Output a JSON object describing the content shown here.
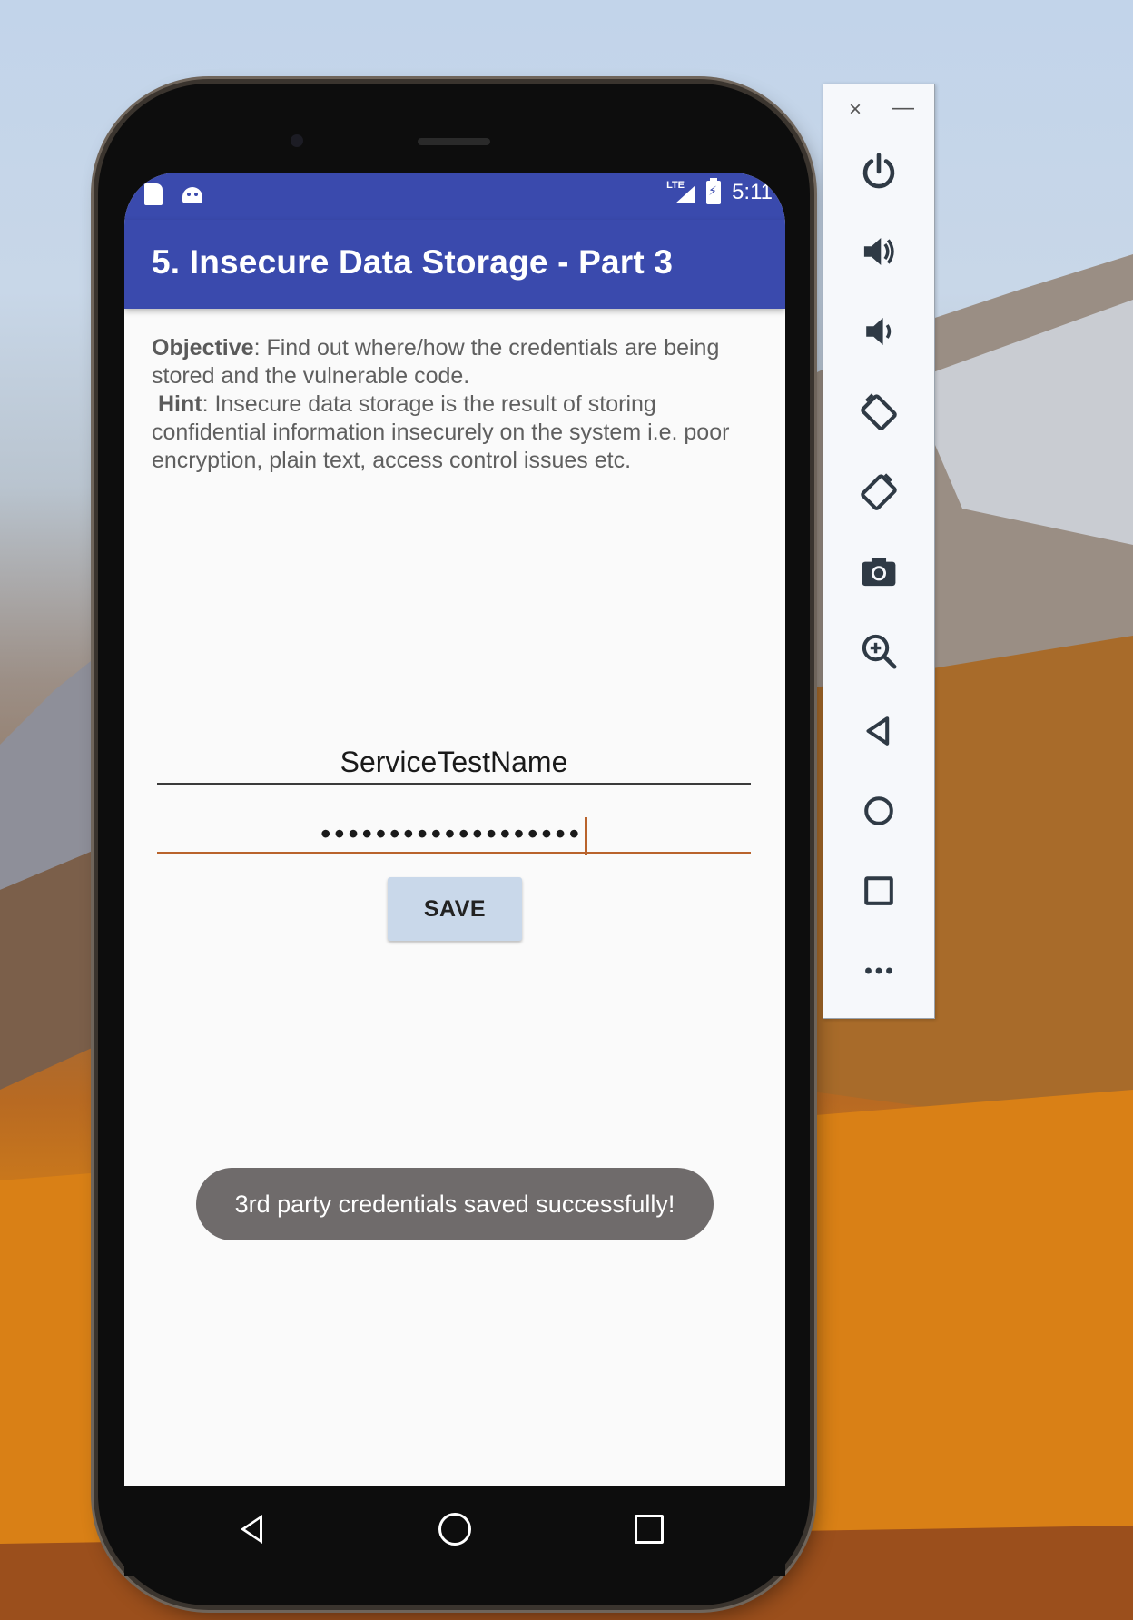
{
  "status_bar": {
    "time": "5:11",
    "network": "LTE"
  },
  "app_bar": {
    "title": "5. Insecure Data Storage - Part 3"
  },
  "content": {
    "objective_label": "Objective",
    "objective_text": ": Find out where/how the credentials are being stored and the vulnerable code.",
    "hint_label": "Hint",
    "hint_text": ": Insecure data storage is the result of storing confidential information insecurely on the system i.e. poor encryption, plain text, access control issues etc."
  },
  "form": {
    "username_value": "ServiceTestName",
    "password_value": "•••••••••••••••••••",
    "save_label": "SAVE"
  },
  "toast": {
    "message": "3rd party credentials saved successfully!"
  },
  "emulator_toolbar": {
    "close": "×",
    "minimize": "—",
    "buttons": [
      "power-icon",
      "volume-up-icon",
      "volume-down-icon",
      "rotate-left-icon",
      "rotate-right-icon",
      "camera-icon",
      "zoom-icon",
      "back-icon",
      "home-icon",
      "overview-icon",
      "more-icon"
    ]
  },
  "colors": {
    "app_bar": "#3a4aad",
    "accent": "#b9632c",
    "toast_bg": "#6f6b6b",
    "button_bg": "#c9d8ea"
  }
}
